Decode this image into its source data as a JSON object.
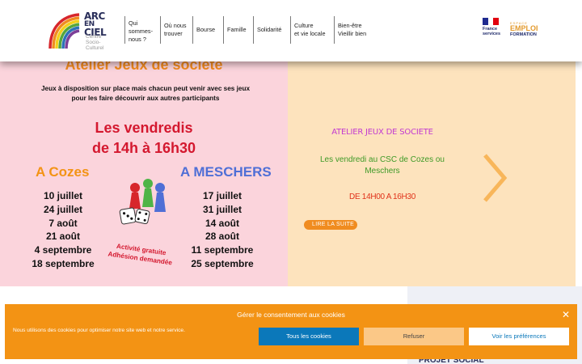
{
  "header": {
    "logo": {
      "line1": "ARC",
      "line2": "EN",
      "line3": "CIEL",
      "sub1": "Centre",
      "sub2": "Socio-",
      "sub3": "Culturel"
    },
    "nav": [
      {
        "line1": "Qui",
        "line2": "sommes-",
        "line3": "nous ?"
      },
      {
        "line1": "Où nous",
        "line2": "trouver",
        "line3": ""
      },
      {
        "line1": "Bourse",
        "line2": "",
        "line3": ""
      },
      {
        "line1": "Famille",
        "line2": "",
        "line3": ""
      },
      {
        "line1": "Solidarité",
        "line2": "",
        "line3": ""
      },
      {
        "line1": "Culture",
        "line2": "et vie locale",
        "line3": ""
      },
      {
        "line1": "Bien-être",
        "line2": "Vieillir bien",
        "line3": ""
      }
    ],
    "france_services": {
      "line1": "France",
      "line2": "services"
    },
    "emploi_formation": {
      "line1": "ESPACE",
      "line2": "EMPLOI",
      "line3": "FORMATION"
    }
  },
  "poster": {
    "title": "Atelier Jeux de société",
    "intro1": "Jeux à disposition sur place mais chacun peut venir avec ses jeux",
    "intro2": "pour les faire découvrir aux autres participants",
    "days1": "Les vendredis",
    "days2": "de 14h à 16h30",
    "cozes": {
      "title": "A Cozes",
      "dates": [
        "10 juillet",
        "24 juillet",
        "7 août",
        "21 août",
        "4 septembre",
        "18 septembre"
      ]
    },
    "meschers": {
      "title": "A MESCHERS",
      "dates": [
        "17 juillet",
        "31 juillet",
        "14 août",
        "28 août",
        "11 septembre",
        "25 septembre"
      ]
    },
    "free1": "Activité gratuite",
    "free2": "Adhésion demandée"
  },
  "slide": {
    "title": "ATELIER JEUX DE SOCIETE",
    "desc": "Les vendredi au CSC de Cozes ou Meschers",
    "time": "DE 14H00 A 16H30",
    "button": "LIRE LA SUITE"
  },
  "lower": {
    "title": "PROJET SOCIAL"
  },
  "cookie": {
    "title": "Gérer le consentement aux cookies",
    "text": "Nous utilisons des cookies pour optimiser notre site web et notre service.",
    "accept": "Tous les cookies",
    "refuse": "Refuser",
    "prefs": "Voir les préférences"
  },
  "colors": {
    "orange": "#f39314",
    "pink_bg": "#fbd4dc",
    "peach_bg": "#fde3bd",
    "blue_btn": "#0b78ba",
    "red": "#d4182f"
  }
}
